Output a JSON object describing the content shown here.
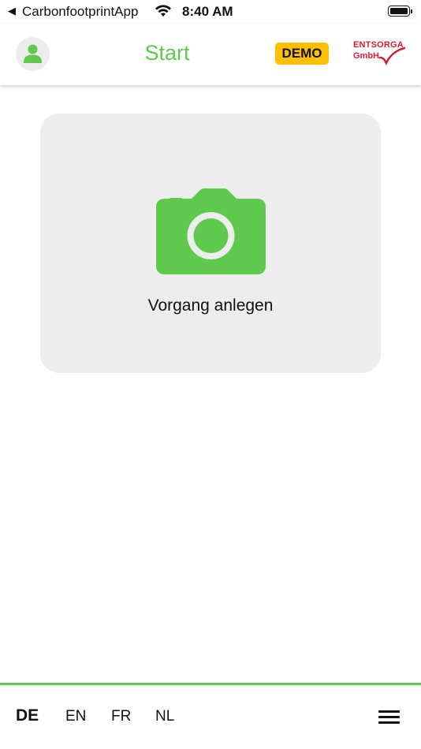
{
  "status_bar": {
    "back_glyph": "◀",
    "app_name": "CarbonfootprintApp",
    "time": "8:40 AM",
    "icons": [
      "wifi-icon",
      "battery-icon"
    ]
  },
  "header": {
    "title": "Start",
    "demo_badge": "DEMO",
    "logo": {
      "line1": "ENTSORGA",
      "line2": "GmbH",
      "color": "#d51f3a"
    },
    "avatar_icon": "person-icon"
  },
  "card": {
    "label": "Vorgang anlegen",
    "icon": "camera-icon"
  },
  "bottom_bar": {
    "languages": [
      "DE",
      "EN",
      "FR",
      "NL"
    ],
    "active_language": "DE",
    "menu_icon": "hamburger-menu-icon"
  },
  "colors": {
    "accent_green": "#5fc94e",
    "demo_yellow": "#ffc000",
    "card_bg": "#ededed"
  }
}
